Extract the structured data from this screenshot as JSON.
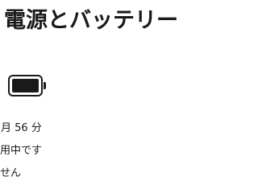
{
  "header": {
    "title": "電源とバッテリー"
  },
  "battery": {
    "icon": "battery-icon",
    "charge_fraction": 1.0
  },
  "status": {
    "remaining_time": "月 56 分",
    "usage_state": "用中です",
    "third_line": "せん"
  }
}
